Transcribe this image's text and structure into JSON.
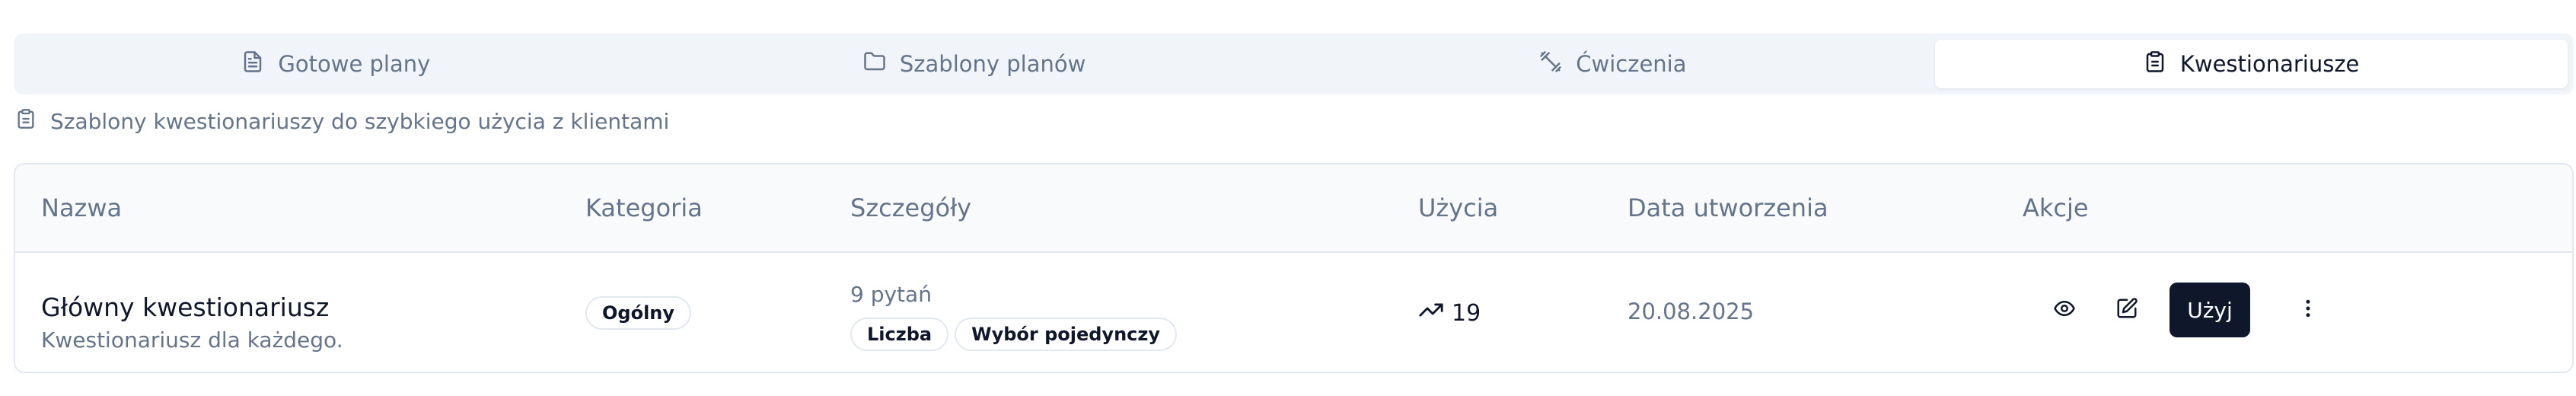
{
  "tabs": [
    {
      "label": "Gotowe plany",
      "icon": "file-text-icon",
      "active": false
    },
    {
      "label": "Szablony planów",
      "icon": "folder-icon",
      "active": false
    },
    {
      "label": "Ćwiczenia",
      "icon": "dumbbell-icon",
      "active": false
    },
    {
      "label": "Kwestionariusze",
      "icon": "clipboard-icon",
      "active": true
    }
  ],
  "description": {
    "icon": "clipboard-icon",
    "text": "Szablony kwestionariuszy do szybkiego użycia z klientami"
  },
  "table": {
    "headers": {
      "name": "Nazwa",
      "category": "Kategoria",
      "details": "Szczegóły",
      "usage": "Użycia",
      "created": "Data utworzenia",
      "actions": "Akcje"
    },
    "rows": [
      {
        "name": "Główny kwestionariusz",
        "subtitle": "Kwestionariusz dla każdego.",
        "category": "Ogólny",
        "question_count": "9 pytań",
        "question_types": [
          "Liczba",
          "Wybór pojedynczy"
        ],
        "usage": "19",
        "usage_icon": "trending-up-icon",
        "created": "20.08.2025",
        "actions": {
          "view_icon": "eye-icon",
          "edit_icon": "edit-icon",
          "use_label": "Użyj",
          "more_icon": "more-vertical-icon"
        }
      }
    ]
  },
  "colors": {
    "primary_button": "#0f172a",
    "muted_text": "#64748b",
    "tab_bar_bg": "#f1f5f9"
  }
}
